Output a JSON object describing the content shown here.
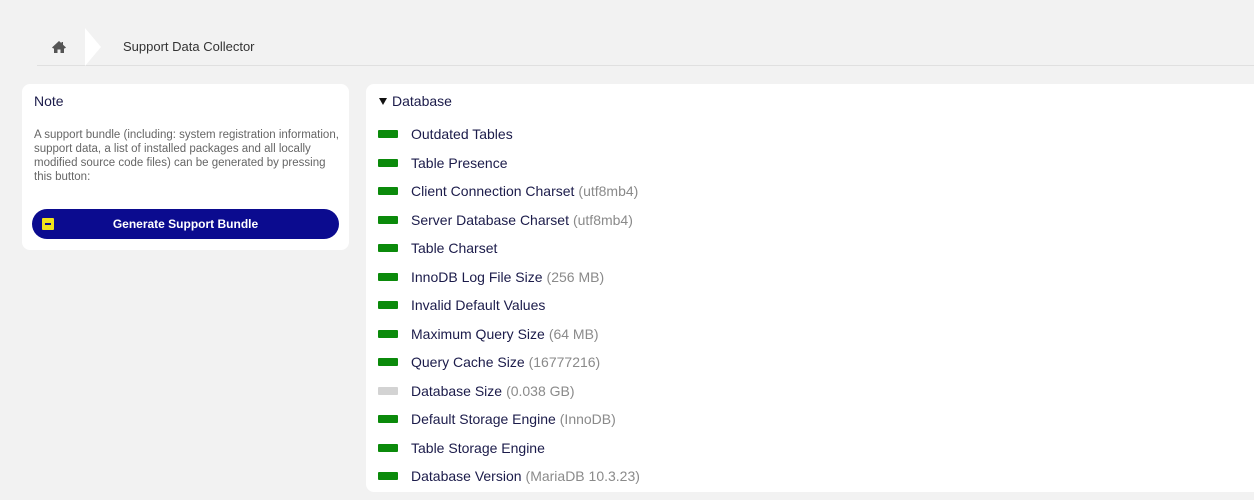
{
  "breadcrumb": {
    "home_icon": "home-icon",
    "current": "Support Data Collector"
  },
  "note": {
    "title": "Note",
    "text": "A support bundle (including: system registration information, support data, a list of installed packages and all locally modified source code files) can be generated by pressing this button:",
    "button_label": "Generate Support Bundle",
    "button_icon": "archive-box-icon"
  },
  "colors": {
    "ok": "#0b8a0b",
    "info": "#d3d3d3",
    "button": "#0b0b8f"
  },
  "section": {
    "title": "Database",
    "items": [
      {
        "label": "Outdated Tables",
        "value": "",
        "status": "ok"
      },
      {
        "label": "Table Presence",
        "value": "",
        "status": "ok"
      },
      {
        "label": "Client Connection Charset",
        "value": "(utf8mb4)",
        "status": "ok"
      },
      {
        "label": "Server Database Charset",
        "value": "(utf8mb4)",
        "status": "ok"
      },
      {
        "label": "Table Charset",
        "value": "",
        "status": "ok"
      },
      {
        "label": "InnoDB Log File Size",
        "value": "(256 MB)",
        "status": "ok"
      },
      {
        "label": "Invalid Default Values",
        "value": "",
        "status": "ok"
      },
      {
        "label": "Maximum Query Size",
        "value": "(64 MB)",
        "status": "ok"
      },
      {
        "label": "Query Cache Size",
        "value": "(16777216)",
        "status": "ok"
      },
      {
        "label": "Database Size",
        "value": "(0.038 GB)",
        "status": "info"
      },
      {
        "label": "Default Storage Engine",
        "value": "(InnoDB)",
        "status": "ok"
      },
      {
        "label": "Table Storage Engine",
        "value": "",
        "status": "ok"
      },
      {
        "label": "Database Version",
        "value": "(MariaDB 10.3.23)",
        "status": "ok"
      }
    ]
  }
}
